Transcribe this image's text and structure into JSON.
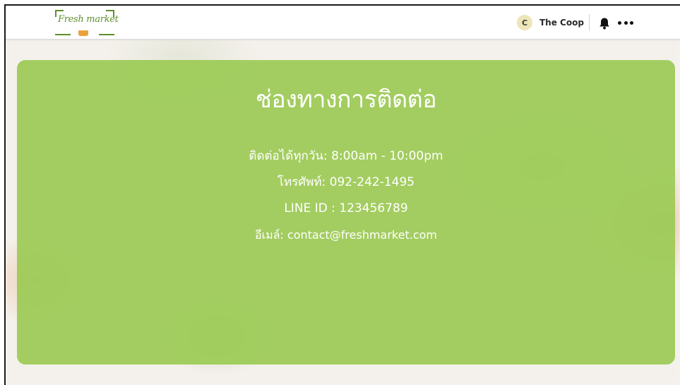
{
  "header": {
    "logo_text": "Fresh market",
    "user_initial": "C",
    "username": "The Coop"
  },
  "icons": [
    "bell-icon",
    "more-icon"
  ],
  "contact": {
    "title": "ช่องทางการติดต่อ",
    "hours": "ติดต่อได้ทุกวัน: 8:00am - 10:00pm",
    "phone": "โทรศัพท์: 092-242-1495",
    "line": "LINE ID : 123456789",
    "email": "อีเมล์: contact@freshmarket.com"
  },
  "colors": {
    "card": "#9cca55",
    "logo": "#5f8f2b",
    "avatar": "#ece6b8"
  }
}
